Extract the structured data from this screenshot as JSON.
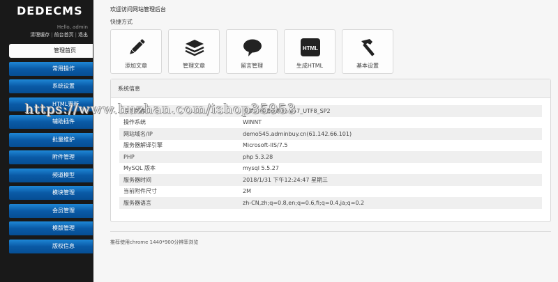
{
  "sidebar": {
    "logo": "DEDECMS",
    "hello": "Hello, admin",
    "links": [
      "清理缓存",
      "前台首页",
      "退出"
    ],
    "items": [
      {
        "label": "管理首页",
        "active": true
      },
      {
        "label": "常用操作"
      },
      {
        "label": "系统设置"
      },
      {
        "label": "HTML更新"
      },
      {
        "label": "辅助插件"
      },
      {
        "label": "批量维护"
      },
      {
        "label": "附件管理"
      },
      {
        "label": "频道模型"
      },
      {
        "label": "模块管理"
      },
      {
        "label": "会员管理"
      },
      {
        "label": "模版管理"
      },
      {
        "label": "版权信息"
      }
    ]
  },
  "main": {
    "welcome": "欢迎访问网站管理后台",
    "shortcut_title": "快捷方式",
    "shortcuts": [
      {
        "label": "添加文章",
        "icon": "pencil-icon"
      },
      {
        "label": "管理文章",
        "icon": "stack-icon"
      },
      {
        "label": "留言管理",
        "icon": "speech-bubble-icon"
      },
      {
        "label": "生成HTML",
        "icon": "html-icon",
        "text": "HTML"
      },
      {
        "label": "基本设置",
        "icon": "hammer-icon"
      }
    ],
    "system_info": {
      "title": "系统信息",
      "rows": [
        {
          "key": "程序版本",
          "value": "织梦内容管理系统 V57_UTF8_SP2"
        },
        {
          "key": "操作系统",
          "value": "WINNT"
        },
        {
          "key": "网站域名/IP",
          "value": "demo545.adminbuy.cn(61.142.66.101)"
        },
        {
          "key": "服务器解译引擎",
          "value": "Microsoft-IIS/7.5"
        },
        {
          "key": "PHP",
          "value": "php 5.3.28"
        },
        {
          "key": "MySQL 版本",
          "value": "mysql 5.5.27"
        },
        {
          "key": "服务器时间",
          "value": "2018/1/31 下午12:24:47 星期三"
        },
        {
          "key": "当前附件尺寸",
          "value": "2M"
        },
        {
          "key": "服务器语言",
          "value": "zh-CN,zh;q=0.8,en;q=0.6,fi;q=0.4,ja;q=0.2"
        }
      ]
    },
    "footer_note": "推荐使用chrome 1440*900分辨率浏览"
  },
  "watermark": "https://www.huzhan.com/ishop35953",
  "colors": {
    "sidebar_bg": "#191919",
    "nav_blue": "#0a5aa6",
    "page_bg": "#f6f6f6"
  }
}
